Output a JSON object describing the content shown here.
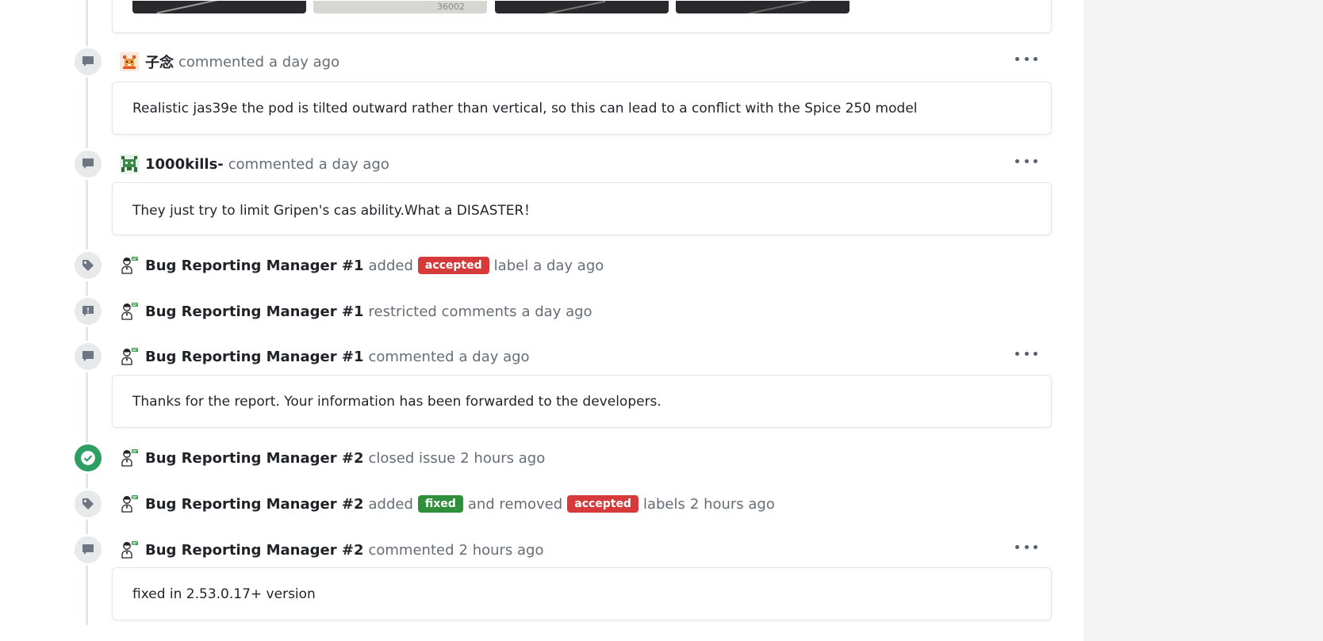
{
  "colors": {
    "accepted": "#d73a3a",
    "fixed": "#2f8f3a",
    "closed_badge": "#2f9e62",
    "right_panel": "#f4f4f5"
  },
  "top_attachment": {
    "thumb_text": "36002"
  },
  "timeline": [
    {
      "type": "comment",
      "icon": "comment-icon",
      "author": "子念",
      "avatar": "pixel-avatar-fox",
      "action": "commented",
      "time": "a day ago",
      "body": "Realistic jas39e the pod is tilted outward rather than vertical, so this can lead to a conflict with the Spice 250 model"
    },
    {
      "type": "comment",
      "icon": "comment-icon",
      "author": "1000kills-",
      "avatar": "pixel-avatar-invader",
      "action": "commented",
      "time": "a day ago",
      "body": "They just try to limit Gripen's cas ability.What a DISASTER！"
    },
    {
      "type": "label",
      "icon": "tag-icon",
      "author": "Bug Reporting Manager #1",
      "action": "added",
      "label": "accepted",
      "after": "label",
      "time": "a day ago"
    },
    {
      "type": "restrict",
      "icon": "alert-comment-icon",
      "author": "Bug Reporting Manager #1",
      "action": "restricted comments",
      "time": "a day ago"
    },
    {
      "type": "comment",
      "icon": "comment-icon",
      "author": "Bug Reporting Manager #1",
      "action": "commented",
      "time": "a day ago",
      "body": "Thanks for the report. Your information has been forwarded to the developers."
    },
    {
      "type": "closed",
      "icon": "check-circle-icon",
      "author": "Bug Reporting Manager #2",
      "action": "closed issue",
      "time": "2 hours ago"
    },
    {
      "type": "labels",
      "icon": "tag-icon",
      "author": "Bug Reporting Manager #2",
      "action": "added",
      "label_added": "fixed",
      "middle": "and removed",
      "label_removed": "accepted",
      "after": "labels",
      "time": "2 hours ago"
    },
    {
      "type": "comment",
      "icon": "comment-icon",
      "author": "Bug Reporting Manager #2",
      "action": "commented",
      "time": "2 hours ago",
      "body": "fixed in 2.53.0.17+ version"
    }
  ]
}
